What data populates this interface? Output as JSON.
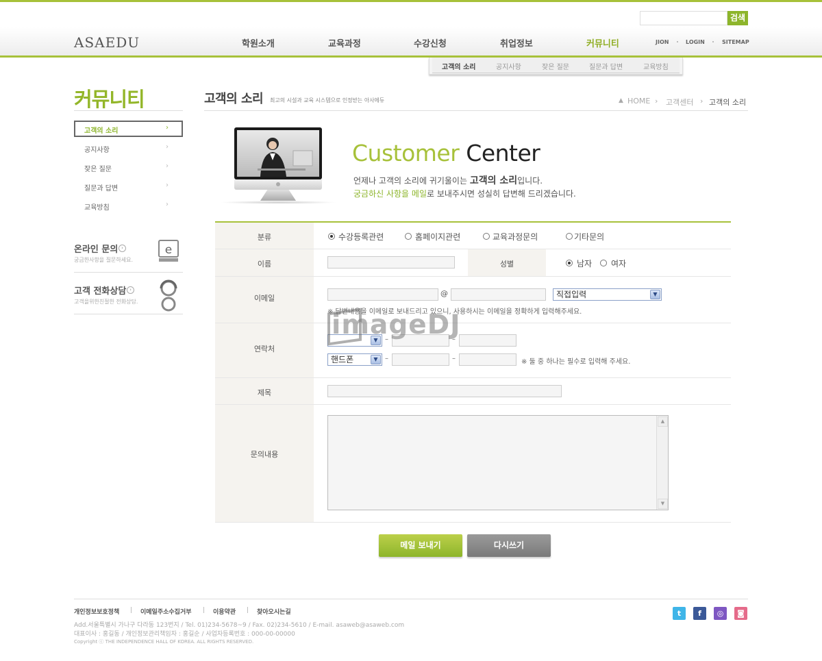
{
  "header": {
    "logo": "ASAEDU",
    "search_button": "검색",
    "nav": [
      "학원소개",
      "교육과정",
      "수강신청",
      "취업정보",
      "커뮤니티"
    ],
    "util": [
      "JION",
      "LOGIN",
      "SITEMAP"
    ],
    "submenu": [
      "고객의 소리",
      "공지사항",
      "잦은 질문",
      "질문과 답변",
      "교육방침"
    ]
  },
  "sidebar": {
    "title": "커뮤니티",
    "items": [
      "고객의 소리",
      "공지사항",
      "잦은 질문",
      "질문과 답변",
      "교육방침"
    ],
    "online_title": "온라인 문의",
    "online_sub": "궁금한사항을 질문하세요.",
    "phone_title": "고객 전화상담",
    "phone_sub": "고객을위한친절한 전화상담."
  },
  "main": {
    "title": "고객의 소리",
    "desc": "최고의 시설과 교육 시스템으로 인정받는 아사에듀",
    "breadcrumb": [
      "HOME",
      "고객센터",
      "고객의 소리"
    ],
    "cc_title_a": "Customer",
    "cc_title_b": "Center",
    "cc_line1_a": "언제나 고객의 소리에 귀기울이는 ",
    "cc_line1_b": "고객의 소리",
    "cc_line1_c": "입니다.",
    "cc_line2_a": "궁금하신 사항을 메일",
    "cc_line2_b": "로 보내주시면 성실히 답변해 드리겠습니다."
  },
  "form": {
    "labels": {
      "category": "분류",
      "name": "이름",
      "gender": "성별",
      "email": "이메일",
      "contact": "연락처",
      "subject": "제목",
      "content": "문의내용"
    },
    "category_options": [
      "수강등록관련",
      "홈페이지관련",
      "교육과정문의",
      "기타문의"
    ],
    "gender_options": [
      "남자",
      "여자"
    ],
    "email_at": "@",
    "email_select": "직접입력",
    "email_note": "※ 답변내용을 이메일로 보내드리고 있으니, 사용하시는 이메일을 정확하게 입력해주세요.",
    "phone_select_1": "",
    "phone_select_2": "핸드폰",
    "contact_note": "※ 둘 중 하나는 필수로 입력해 주세요.",
    "send_button": "메일 보내기",
    "reset_button": "다시쓰기"
  },
  "watermark": "imageDJ",
  "footer": {
    "links": [
      "개인정보보호정책",
      "이메일주소수집거부",
      "이용약관",
      "찾아오시는길"
    ],
    "info1": "Add.서울특별시 가나구 다라동 123번지  / Tel. 01)234-5678~9  / Fax. 02)234-5610  / E-mail. asaweb@asaweb.com",
    "info2": "대표이사 : 홍길동 / 개인정보관리책임자 : 홍길순 / 사업자등록번호 : 000-00-00000",
    "info3": "Copyright ⓒ THE INDEPENDENCE HALL OF KOREA. ALL RIGHTS RESERVED."
  }
}
